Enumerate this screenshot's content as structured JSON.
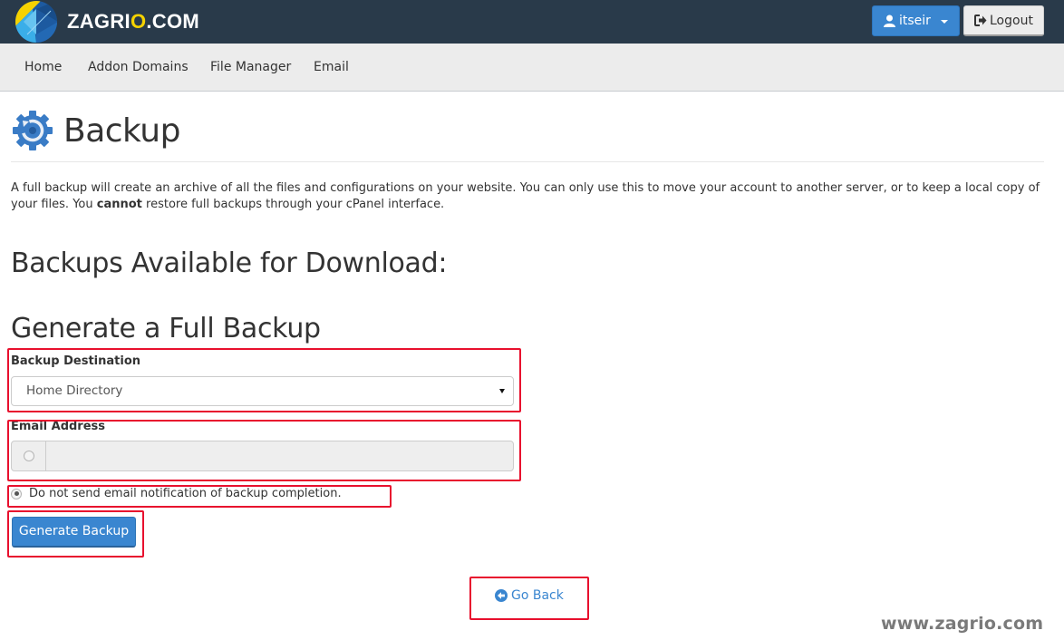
{
  "header": {
    "brand_prefix": "ZAGRI",
    "brand_accent": "O",
    "brand_suffix": ".COM",
    "user_menu_label": "itseir",
    "logout_label": "Logout",
    "colors": {
      "topbar": "#293a4a",
      "accent": "#3a86d0",
      "brand_yellow": "#f5d200"
    }
  },
  "nav": {
    "items": [
      {
        "label": "Home"
      },
      {
        "label": "Addon Domains"
      },
      {
        "label": "File Manager"
      },
      {
        "label": "Email"
      }
    ]
  },
  "page": {
    "title": "Backup",
    "icon": "gear-backup-icon",
    "description_part1": "A full backup will create an archive of all the files and configurations on your website. You can only use this to move your account to another server, or to keep a local copy of your files. You ",
    "description_bold": "cannot",
    "description_part2": " restore full backups through your cPanel interface.",
    "available_heading": "Backups Available for Download:",
    "generate_heading": "Generate a Full Backup"
  },
  "form": {
    "destination_label": "Backup Destination",
    "destination_value": "Home Directory",
    "email_label": "Email Address",
    "email_value": "",
    "email_radio_checked": false,
    "no_email_label": "Do not send email notification of backup completion.",
    "no_email_checked": true,
    "generate_button": "Generate Backup",
    "go_back_label": "Go Back"
  },
  "annotations": {
    "highlight_color": "#e8102e"
  },
  "watermark": "www.zagrio.com"
}
